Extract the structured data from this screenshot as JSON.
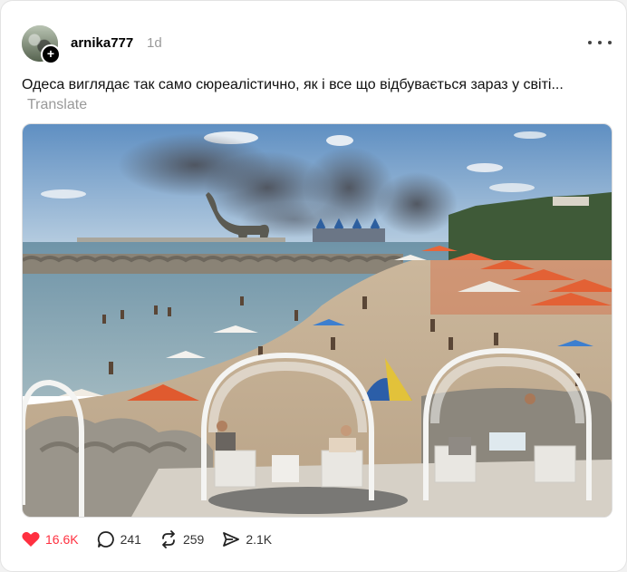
{
  "post": {
    "username": "arnika777",
    "time": "1d",
    "text": "Одеса виглядає так само сюреалістично, як і все що відбувається зараз у світі...",
    "translate_label": "Translate",
    "avatar_badge": "+"
  },
  "stats": {
    "likes": "16.6K",
    "replies": "241",
    "reposts": "259",
    "shares": "2.1K"
  },
  "colors": {
    "like": "#ff3040",
    "muted": "#999999"
  },
  "icons": {
    "like": "heart-icon",
    "reply": "comment-icon",
    "repost": "repost-icon",
    "share": "share-icon",
    "more": "more-icon"
  }
}
